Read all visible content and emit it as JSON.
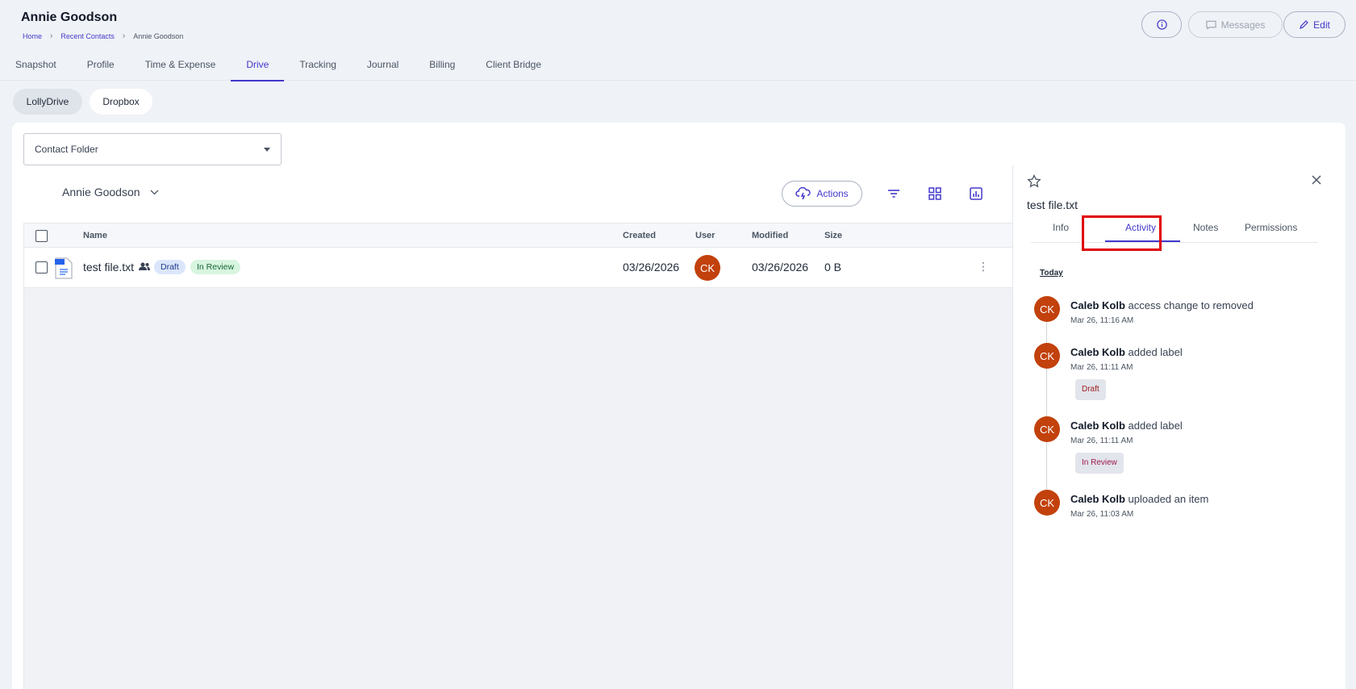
{
  "header": {
    "title": "Annie Goodson",
    "breadcrumb": [
      "Home",
      "Recent Contacts",
      "Annie Goodson"
    ],
    "messages_label": "Messages",
    "edit_label": "Edit"
  },
  "tabs": [
    "Snapshot",
    "Profile",
    "Time & Expense",
    "Drive",
    "Tracking",
    "Journal",
    "Billing",
    "Client Bridge"
  ],
  "active_tab": "Drive",
  "sources": [
    "LollyDrive",
    "Dropbox"
  ],
  "folder_select": {
    "value": "Contact Folder"
  },
  "owner_select": "Annie Goodson",
  "toolbar": {
    "actions_label": "Actions"
  },
  "table": {
    "columns": [
      "Name",
      "Created",
      "User",
      "Modified",
      "Size"
    ],
    "rows": [
      {
        "name": "test file.txt",
        "labels": [
          "Draft",
          "In Review"
        ],
        "created": "03/26/2026",
        "user_initials": "CK",
        "modified": "03/26/2026",
        "size": "0 B"
      }
    ]
  },
  "side_panel": {
    "filename": "test file.txt",
    "tabs": [
      "Info",
      "Activity",
      "Notes",
      "Permissions"
    ],
    "active_tab": "Activity",
    "group_label": "Today",
    "activities": [
      {
        "initials": "CK",
        "user": "Caleb Kolb",
        "action": "access change to removed",
        "time": "Mar 26, 11:16 AM",
        "label": ""
      },
      {
        "initials": "CK",
        "user": "Caleb Kolb",
        "action": "added label",
        "time": "Mar 26, 11:11 AM",
        "label": "Draft"
      },
      {
        "initials": "CK",
        "user": "Caleb Kolb",
        "action": "added label",
        "time": "Mar 26, 11:11 AM",
        "label": "In Review"
      },
      {
        "initials": "CK",
        "user": "Caleb Kolb",
        "action": "uploaded an item",
        "time": "Mar 26, 11:03 AM",
        "label": ""
      }
    ]
  },
  "colors": {
    "accent": "#4338ca",
    "avatar": "#c2410c",
    "highlight": "#e00000"
  }
}
